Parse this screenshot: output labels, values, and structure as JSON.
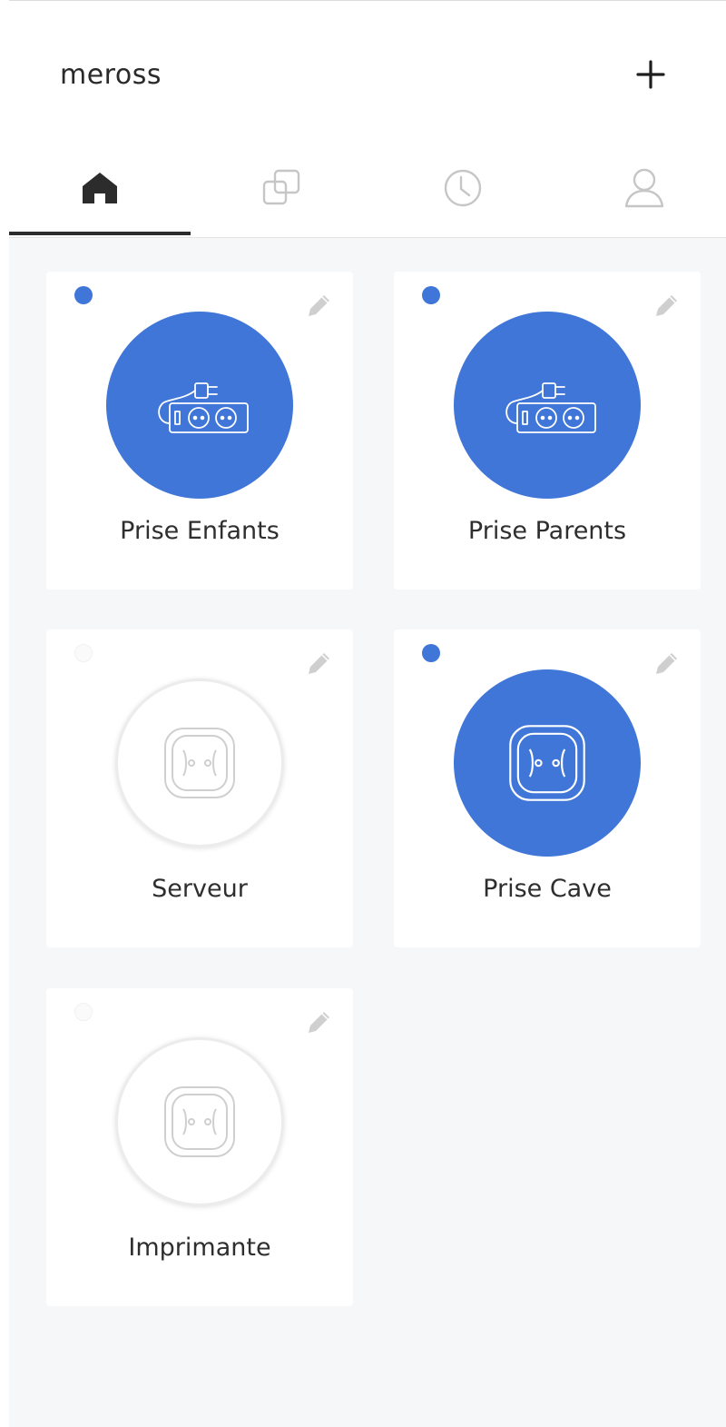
{
  "app": {
    "brand": "meross"
  },
  "tabs": [
    {
      "id": "home",
      "icon": "home-icon",
      "active": true
    },
    {
      "id": "scenes",
      "icon": "scenes-icon",
      "active": false
    },
    {
      "id": "timers",
      "icon": "clock-icon",
      "active": false
    },
    {
      "id": "profile",
      "icon": "user-icon",
      "active": false
    }
  ],
  "devices": [
    {
      "name": "Prise Enfants",
      "status": "on",
      "type": "power-strip"
    },
    {
      "name": "Prise Parents",
      "status": "on",
      "type": "power-strip"
    },
    {
      "name": "Serveur",
      "status": "off",
      "type": "smart-plug"
    },
    {
      "name": "Prise Cave",
      "status": "on",
      "type": "smart-plug"
    },
    {
      "name": "Imprimante",
      "status": "off",
      "type": "smart-plug"
    }
  ],
  "colors": {
    "accent": "#3f76d8",
    "background": "#f6f7f9",
    "card": "#ffffff",
    "text": "#2e2e2e",
    "icon_inactive": "#c6c6c6"
  }
}
